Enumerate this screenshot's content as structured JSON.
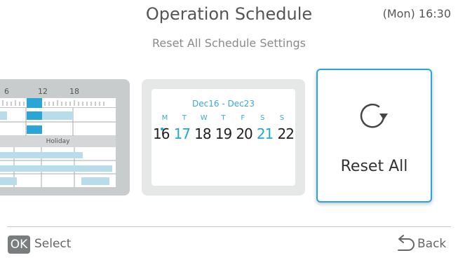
{
  "header": {
    "title": "Operation Schedule",
    "clock": "(Mon) 16:30",
    "subtitle": "Reset All Schedule Settings"
  },
  "week_card": {
    "tick_labels": [
      "6",
      "12",
      "18"
    ],
    "holiday_label": "Holiday"
  },
  "calendar_card": {
    "range": "Dec16 - Dec23",
    "weekdays": [
      "M",
      "T",
      "W",
      "T",
      "F",
      "S",
      "S"
    ],
    "dates": [
      "16",
      "17",
      "18",
      "19",
      "20",
      "21",
      "22"
    ],
    "highlight_color": "#1fa9d9"
  },
  "reset_card": {
    "label": "Reset All",
    "icon": "reset-arrow-icon",
    "border_color": "#2aa6d6"
  },
  "footer": {
    "ok_badge": "OK",
    "ok_label": "Select",
    "back_label": "Back",
    "back_icon": "return-arrow-icon"
  }
}
